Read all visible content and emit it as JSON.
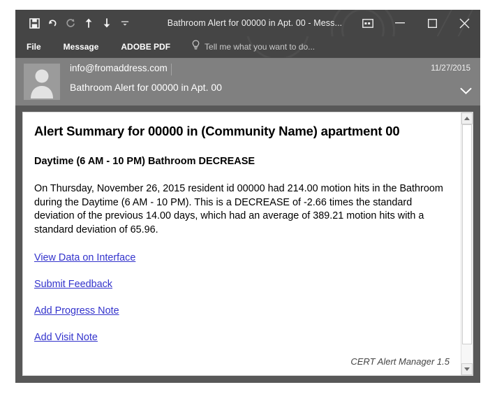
{
  "window": {
    "title": "Bathroom Alert for 00000 in Apt. 00 - Mess...",
    "quick_access": [
      {
        "name": "save-icon",
        "label": "Save"
      },
      {
        "name": "undo-icon",
        "label": "Undo"
      },
      {
        "name": "redo-icon",
        "label": "Redo"
      },
      {
        "name": "previous-item-icon",
        "label": "Previous Item"
      },
      {
        "name": "next-item-icon",
        "label": "Next Item"
      },
      {
        "name": "customize-quick-access-toolbar-icon",
        "label": "Customize Quick Access Toolbar"
      }
    ],
    "controls": [
      {
        "name": "ribbon-display-options-icon",
        "label": "Ribbon Display Options"
      },
      {
        "name": "minimize-icon",
        "label": "Minimize"
      },
      {
        "name": "maximize-icon",
        "label": "Maximize"
      },
      {
        "name": "close-icon",
        "label": "Close"
      }
    ]
  },
  "ribbon": {
    "tabs": [
      {
        "label": "File"
      },
      {
        "label": "Message"
      },
      {
        "label": "ADOBE PDF"
      }
    ],
    "tellme": {
      "icon": "lightbulb-icon",
      "placeholder": "Tell me what you want to do..."
    }
  },
  "message": {
    "avatar_icon": "contact-photo-icon",
    "sender": "info@fromaddress.com",
    "subject": "Bathroom Alert for 00000 in Apt. 00",
    "date": "11/27/2015",
    "expand_icon": "chevron-down-icon"
  },
  "body": {
    "title": "Alert Summary for 00000 in (Community Name) apartment 00",
    "subtitle": "Daytime (6 AM - 10 PM) Bathroom DECREASE",
    "paragraph": "On Thursday, November 26, 2015 resident id 00000 had 214.00 motion hits in the Bathroom during the Daytime (6 AM - 10 PM). This is a DECREASE of -2.66 times the standard deviation of the previous 14.00 days, which had an average of 389.21 motion hits with a standard deviation of 65.96.",
    "links": [
      {
        "label": "View Data on Interface"
      },
      {
        "label": "Submit Feedback"
      },
      {
        "label": "Add Progress Note"
      },
      {
        "label": "Add Visit Note"
      }
    ],
    "footer": "CERT Alert Manager 1.5",
    "link_color": "#3333cc"
  },
  "scrollbar": {
    "up_icon": "scroll-up-icon",
    "down_icon": "scroll-down-icon"
  },
  "colors": {
    "titlebar": "#454545",
    "header": "#808080",
    "frame": "#585858",
    "body_bg": "#ffffff"
  }
}
